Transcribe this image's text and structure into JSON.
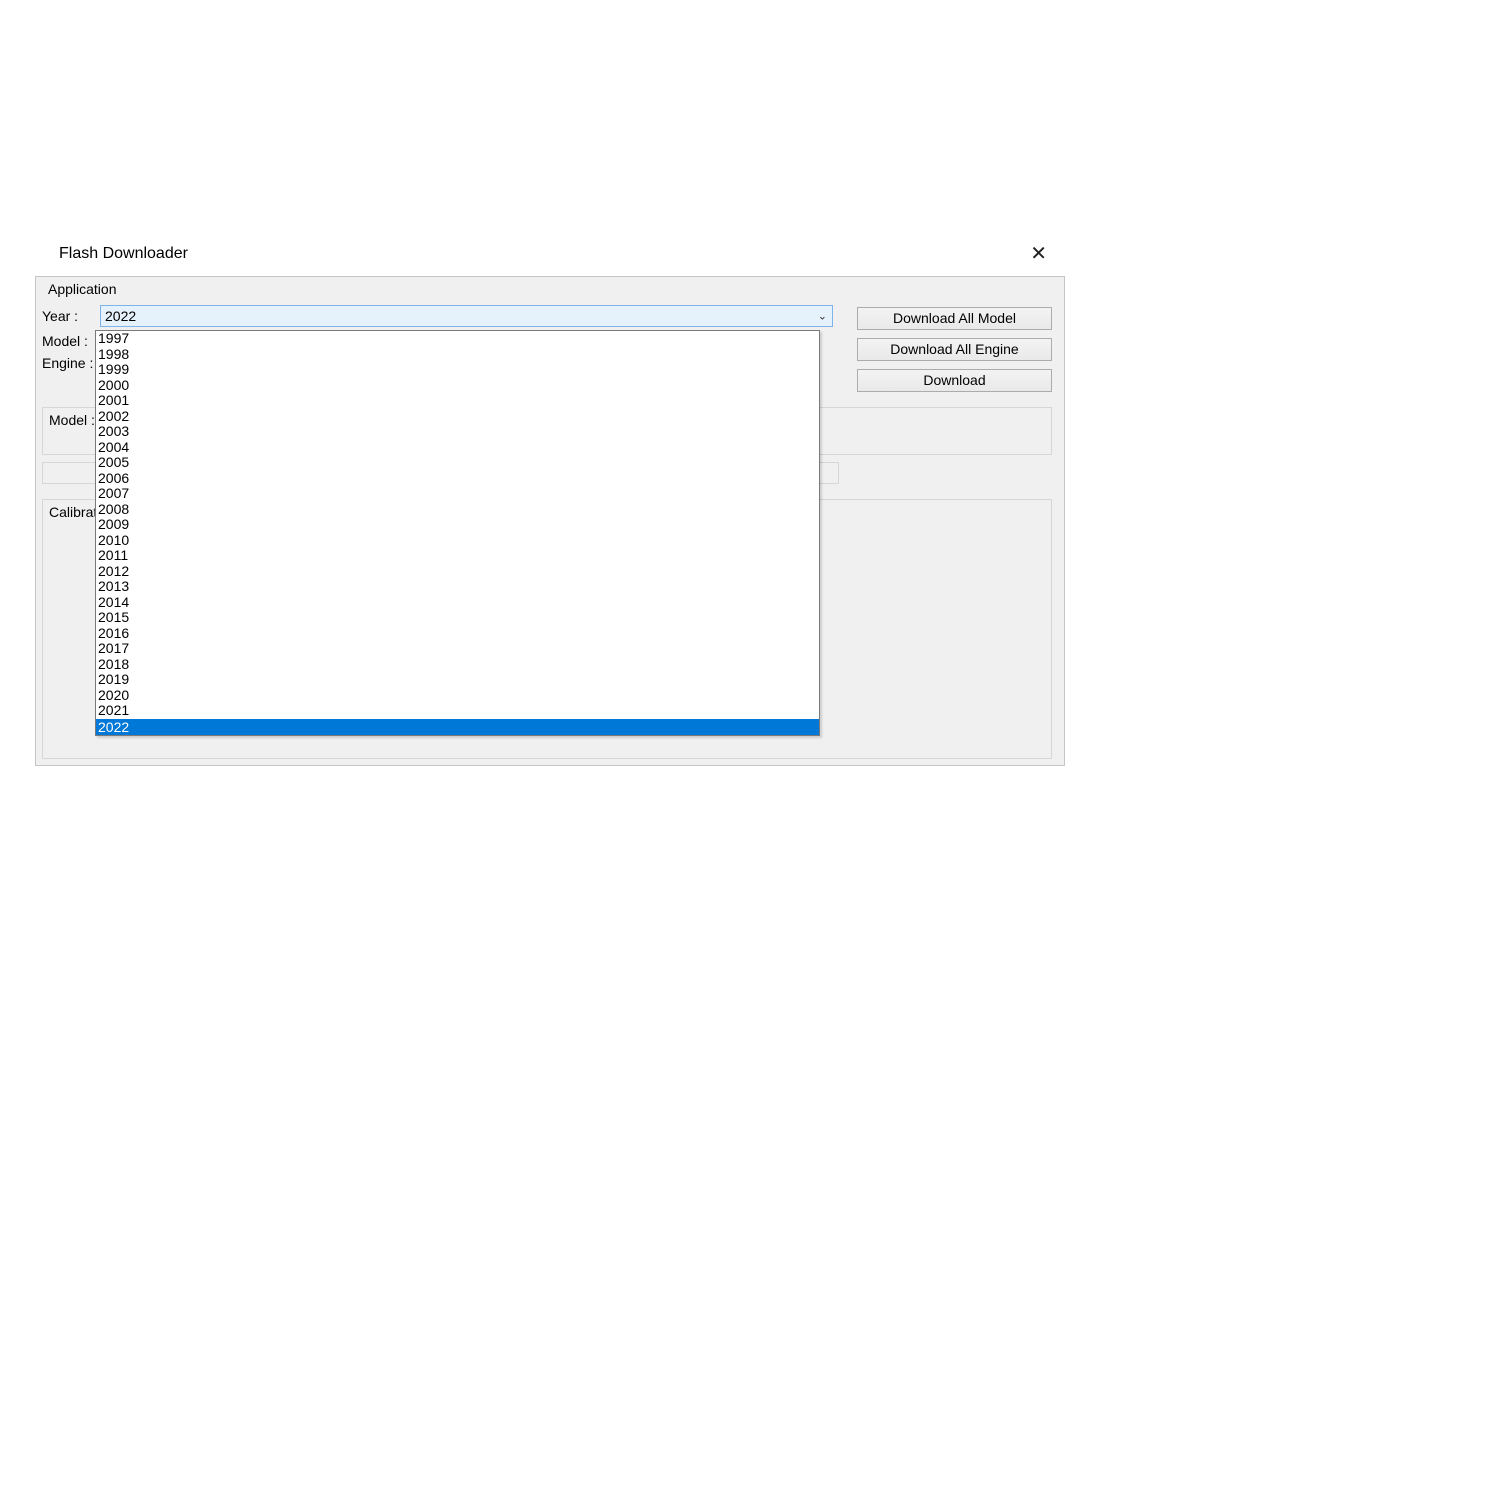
{
  "window": {
    "title": "Flash Downloader"
  },
  "menubar": {
    "application": "Application"
  },
  "labels": {
    "year": "Year :",
    "model": "Model :",
    "engine": "Engine :",
    "model_panel": "Model : L",
    "calibration_panel": "Calibration"
  },
  "year_combo": {
    "selected": "2022",
    "options": [
      "1997",
      "1998",
      "1999",
      "2000",
      "2001",
      "2002",
      "2003",
      "2004",
      "2005",
      "2006",
      "2007",
      "2008",
      "2009",
      "2010",
      "2011",
      "2012",
      "2013",
      "2014",
      "2015",
      "2016",
      "2017",
      "2018",
      "2019",
      "2020",
      "2021",
      "2022"
    ]
  },
  "buttons": {
    "download_all_model": "Download All Model",
    "download_all_engine": "Download All Engine",
    "download": "Download"
  }
}
